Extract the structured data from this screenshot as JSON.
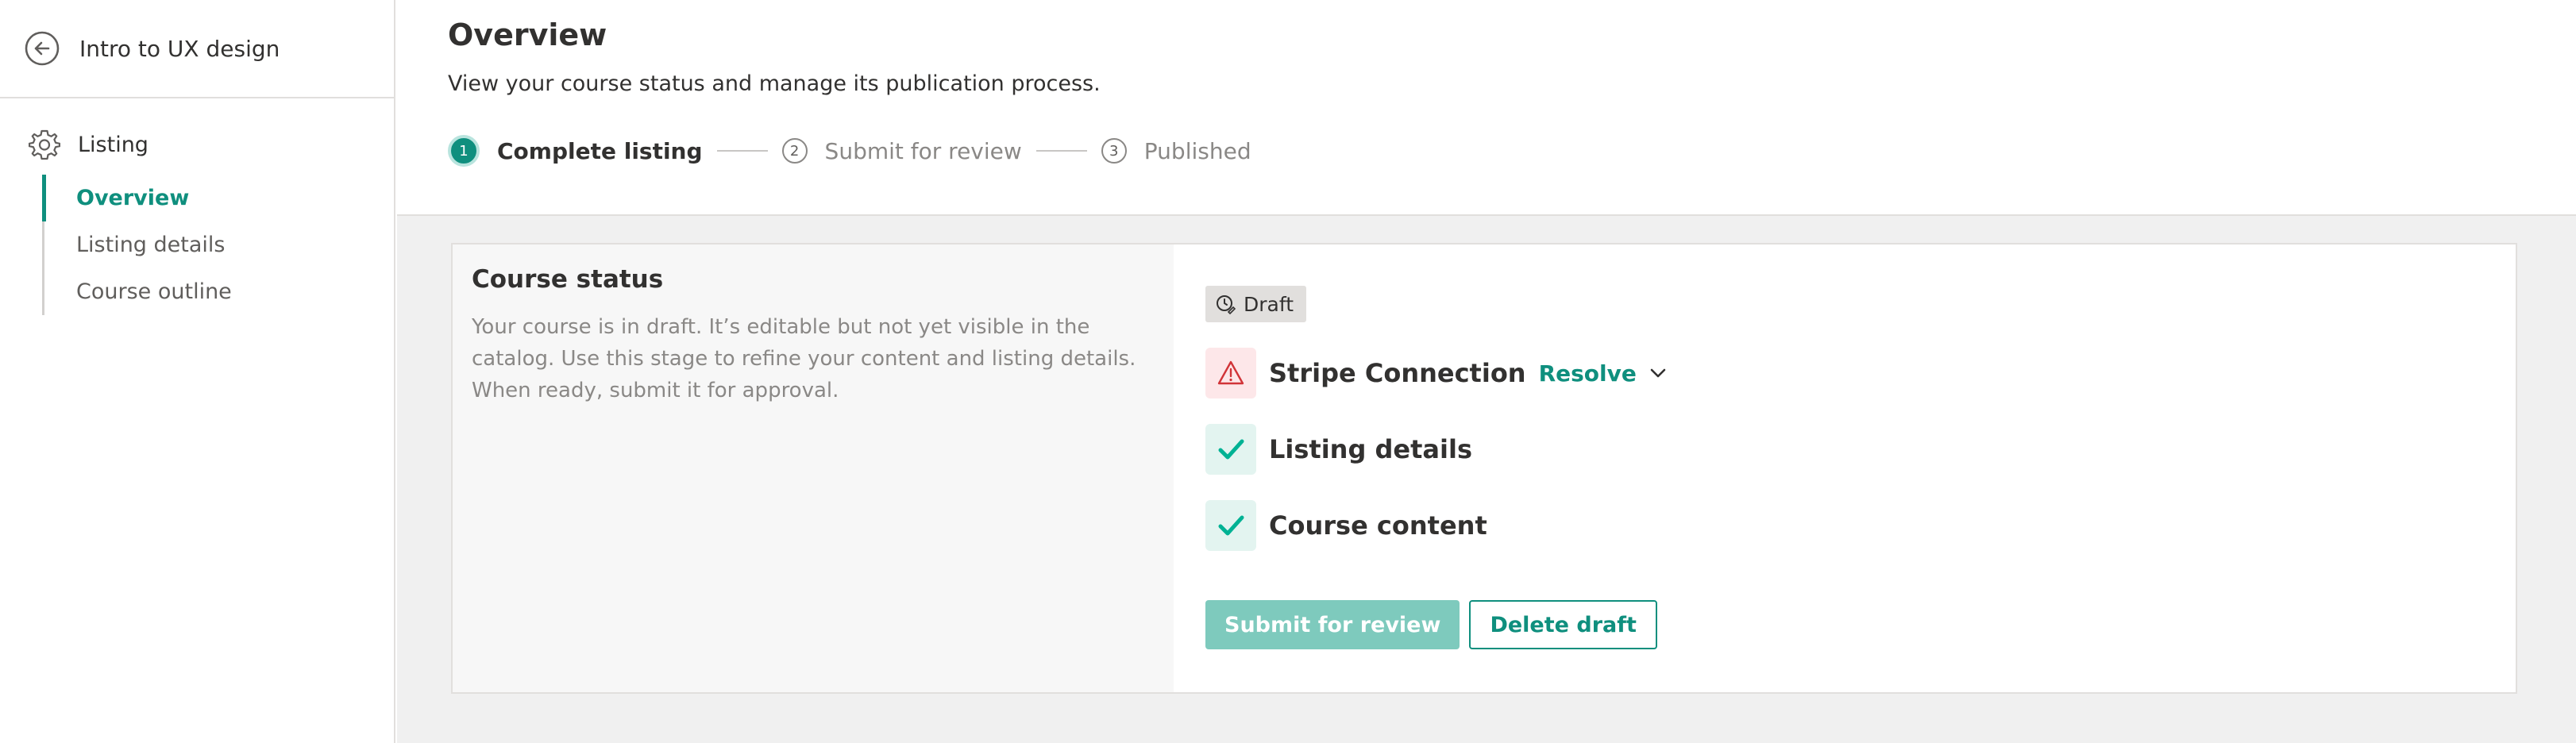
{
  "sidebar": {
    "course_title": "Intro to UX design",
    "section_label": "Listing",
    "items": [
      {
        "label": "Overview",
        "active": true
      },
      {
        "label": "Listing details",
        "active": false
      },
      {
        "label": "Course outline",
        "active": false
      }
    ]
  },
  "header": {
    "title": "Overview",
    "subtitle": "View your course status and manage its publication process."
  },
  "stepper": {
    "steps": [
      {
        "number": "1",
        "label": "Complete listing",
        "state": "active"
      },
      {
        "number": "2",
        "label": "Submit for review",
        "state": "pending"
      },
      {
        "number": "3",
        "label": "Published",
        "state": "pending"
      }
    ]
  },
  "status_card": {
    "title": "Course status",
    "description": "Your course is in draft. It’s editable but not yet visible in the catalog. Use this stage to refine your content and listing details. When ready, submit it for approval.",
    "badge": "Draft",
    "checks": [
      {
        "label": "Stripe Connection",
        "state": "warning",
        "icon": "warning-icon",
        "action": "Resolve"
      },
      {
        "label": "Listing details",
        "state": "complete",
        "icon": "check-icon"
      },
      {
        "label": "Course content",
        "state": "complete",
        "icon": "check-icon"
      }
    ],
    "primary_button": "Submit for review",
    "secondary_button": "Delete draft"
  },
  "colors": {
    "accent": "#0f8f7e",
    "accent_disabled": "#7ecabd",
    "warning": "#d13438",
    "check": "#00b294"
  }
}
